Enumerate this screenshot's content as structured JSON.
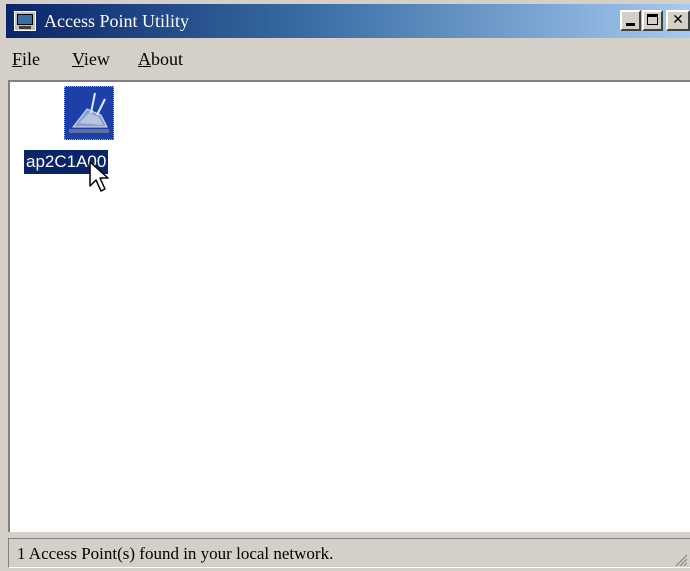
{
  "window": {
    "title": "Access Point Utility"
  },
  "menu": {
    "file": {
      "accel": "F",
      "rest": "ile"
    },
    "view": {
      "accel": "V",
      "rest": "iew"
    },
    "about": {
      "accel": "A",
      "rest": "bout"
    }
  },
  "devices": [
    {
      "name": "ap2C1A00",
      "icon": "access-point-icon",
      "selected": true
    }
  ],
  "status": {
    "text": "1 Access Point(s) found in your local network."
  },
  "colors": {
    "titlebar_start": "#0a246a",
    "titlebar_end": "#a6caf0",
    "selection": "#0a246a",
    "chrome": "#d4d0c8"
  }
}
